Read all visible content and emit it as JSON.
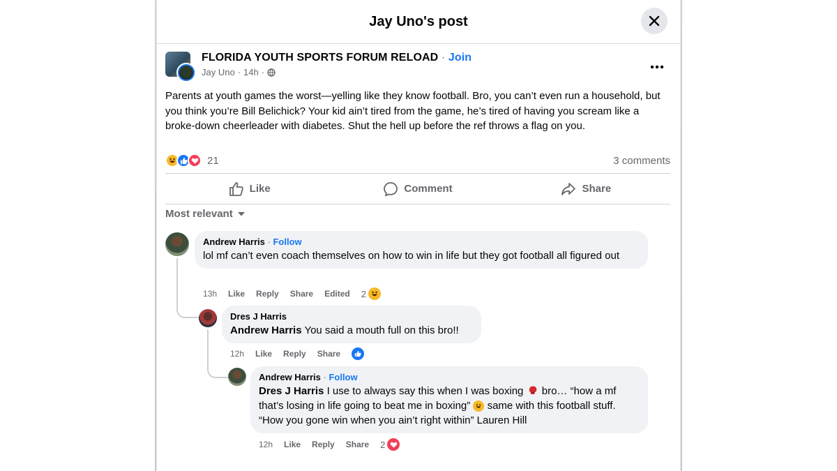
{
  "modal": {
    "title": "Jay Uno's post"
  },
  "post": {
    "group_name": "FLORIDA YOUTH SPORTS FORUM RELOAD",
    "join_label": "Join",
    "author": "Jay Uno",
    "time": "14h",
    "text": "Parents at youth games the worst—yelling like they know football. Bro, you can’t even run a household, but you think you’re Bill Belichick? Your kid ain’t tired from the game, he’s tired of having you scream like a broke-down cheerleader with diabetes. Shut the hell up before the ref throws a flag on you.",
    "reaction_count": "21",
    "comments_count": "3 comments",
    "actions": {
      "like": "Like",
      "comment": "Comment",
      "share": "Share"
    }
  },
  "sort_label": "Most relevant",
  "comments": [
    {
      "name": "Andrew Harris",
      "follow": "Follow",
      "text": "lol mf can’t even coach themselves on how to win in life but they got football all figured out",
      "time": "13h",
      "like": "Like",
      "reply": "Reply",
      "share": "Share",
      "edited": "Edited",
      "reaction_count": "2"
    },
    {
      "name": "Dres J Harris",
      "mention": "Andrew Harris",
      "text": " You said a mouth full on this bro!!",
      "time": "12h",
      "like": "Like",
      "reply": "Reply",
      "share": "Share"
    },
    {
      "name": "Andrew Harris",
      "follow": "Follow",
      "mention": "Dres J Harris",
      "text1": " I use to always say this when I was boxing ",
      "text2": " bro… “how a mf that’s losing in life going to beat me in boxing” ",
      "text3": " same with this football stuff. “How you gone win when you ain’t right within” Lauren Hill",
      "time": "12h",
      "like": "Like",
      "reply": "Reply",
      "share": "Share",
      "reaction_count": "2"
    }
  ],
  "icons": {
    "close": "close-icon",
    "globe": "globe-icon",
    "more": "more-icon",
    "like": "thumbs-up-icon",
    "comment": "comment-icon",
    "share": "share-icon",
    "haha": "haha-icon",
    "love": "heart-icon",
    "boxing": "boxing-glove-icon"
  },
  "colors": {
    "accent": "#1877f2",
    "secondary_text": "#65676b",
    "bubble": "#f0f2f5",
    "love": "#f33e58",
    "haha": "#f7b928"
  }
}
